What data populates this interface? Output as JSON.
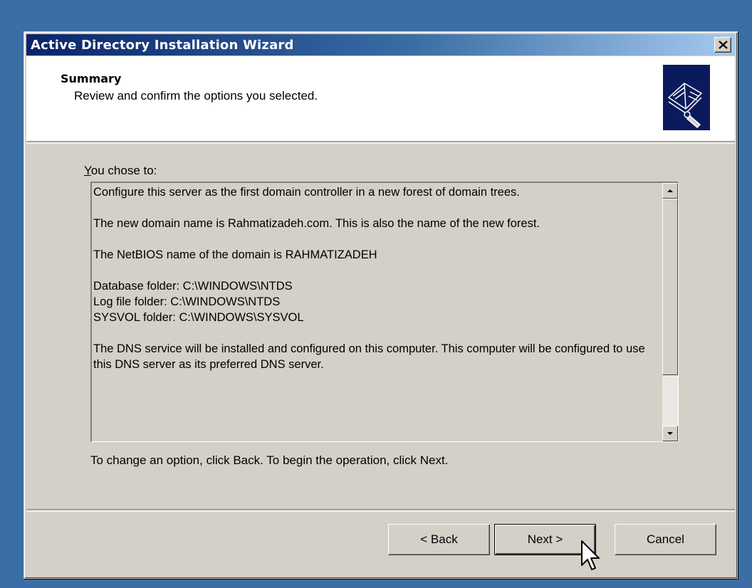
{
  "window": {
    "title": "Active Directory Installation Wizard",
    "close_icon": "close-icon"
  },
  "header": {
    "title": "Summary",
    "subtitle": "Review and confirm the options you selected.",
    "icon": "directory-book-icon"
  },
  "content": {
    "chose_label_prefix": "Y",
    "chose_label_rest": "ou chose to:",
    "summary_lines": [
      "Configure this server as the first domain controller in a new forest of domain trees.",
      "",
      "The new domain name is Rahmatizadeh.com. This is also the name of the new forest.",
      "",
      "The NetBIOS name of the domain is RAHMATIZADEH",
      "",
      "Database folder: C:\\WINDOWS\\NTDS",
      "Log file folder: C:\\WINDOWS\\NTDS",
      "SYSVOL folder: C:\\WINDOWS\\SYSVOL",
      "",
      "The DNS service will be installed and configured on this computer. This computer will be configured to use this DNS server as its preferred DNS server."
    ],
    "footer_note": "To change an option, click Back. To begin the operation, click Next."
  },
  "buttons": {
    "back": "< Back",
    "next": "Next >",
    "cancel": "Cancel"
  }
}
